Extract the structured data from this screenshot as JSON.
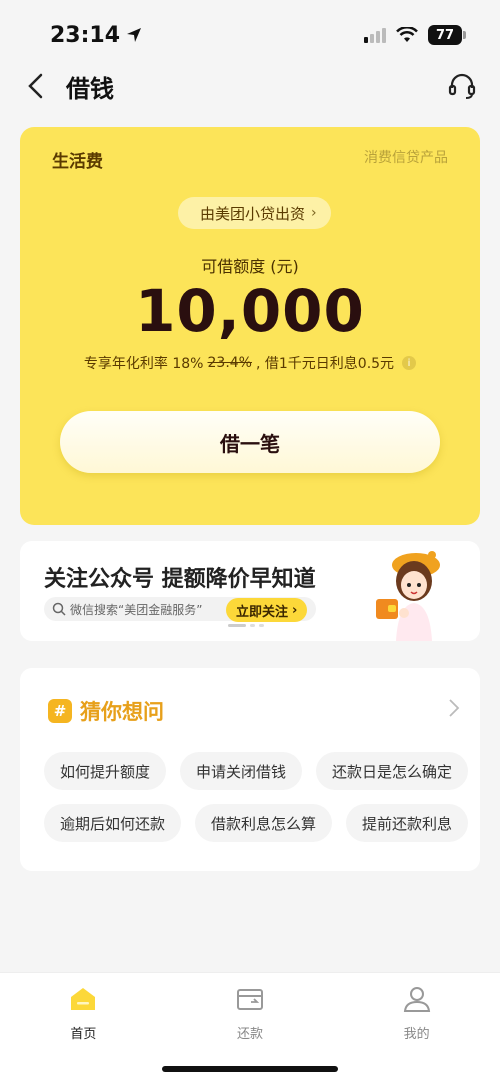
{
  "status": {
    "time": "23:14",
    "battery": "77"
  },
  "nav": {
    "title": "借钱"
  },
  "card": {
    "label": "生活费",
    "sub": "消费信贷产品",
    "lender": "由美团小贷出资",
    "quota_label": "可借额度 (元)",
    "amount": "10,000",
    "rate_prefix": "专享年化利率 18%",
    "rate_old": "23.4%",
    "rate_suffix": ", 借1千元日利息0.5元",
    "borrow_label": "借一笔"
  },
  "banner": {
    "title": "关注公众号 提额降价早知道",
    "search_text": "微信搜索“美团金融服务”",
    "follow_label": "立即关注"
  },
  "guess": {
    "title": "猜你想问",
    "row1": [
      "如何提升额度",
      "申请关闭借钱",
      "还款日是怎么确定"
    ],
    "row2": [
      "逾期后如何还款",
      "借款利息怎么算",
      "提前还款利息"
    ]
  },
  "tabs": [
    {
      "label": "首页"
    },
    {
      "label": "还款"
    },
    {
      "label": "我的"
    }
  ],
  "colors": {
    "accent": "#fce459",
    "brand_yellow": "#fcd839",
    "guess_title": "#e7a01b"
  }
}
